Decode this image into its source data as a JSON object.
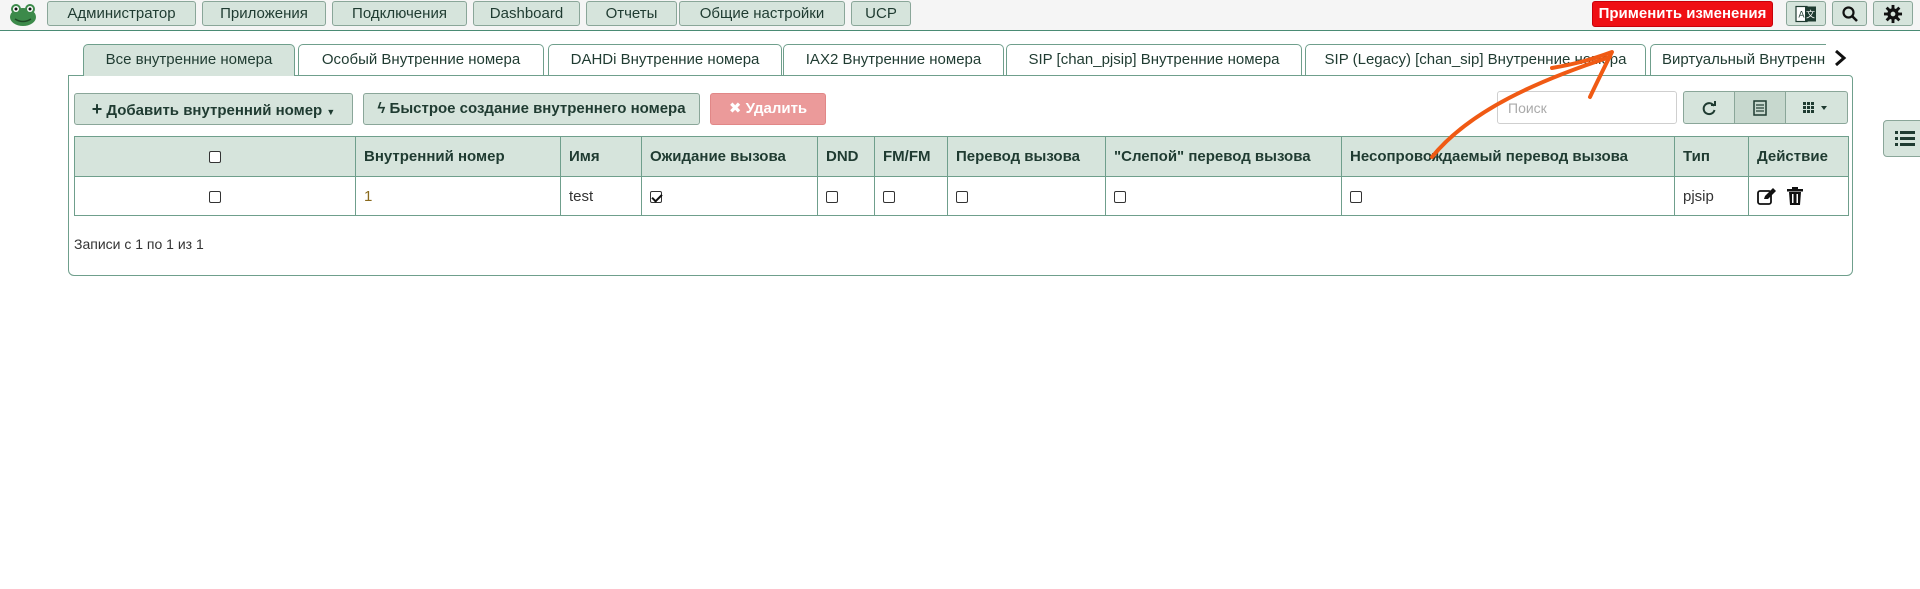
{
  "navbar": {
    "menu": [
      {
        "label": "Администратор"
      },
      {
        "label": "Приложения"
      },
      {
        "label": "Подключения"
      },
      {
        "label": "Dashboard"
      },
      {
        "label": "Отчеты"
      },
      {
        "label": "Общие настройки"
      },
      {
        "label": "UCP"
      }
    ],
    "apply_label": "Применить изменения"
  },
  "tabs": [
    {
      "label": "Все внутренние номера",
      "active": true
    },
    {
      "label": "Особый Внутренние номера"
    },
    {
      "label": "DAHDi Внутренние номера"
    },
    {
      "label": "IAX2 Внутренние номера"
    },
    {
      "label": "SIP [chan_pjsip] Внутренние номера"
    },
    {
      "label": "SIP (Legacy) [chan_sip] Внутренние номера"
    },
    {
      "label": "Виртуальный Внутренние номера"
    }
  ],
  "toolbar": {
    "add_label": "Добавить внутренний номер",
    "quick_create_label": "Быстрое создание внутреннего номера",
    "delete_label": "Удалить",
    "search_placeholder": "Поиск"
  },
  "table": {
    "columns": [
      "",
      "Внутренний номер",
      "Имя",
      "Ожидание вызова",
      "DND",
      "FM/FM",
      "Перевод вызова",
      "\"Слепой\" перевод вызова",
      "Несопровождаемый перевод вызова",
      "Тип",
      "Действие"
    ],
    "rows": [
      {
        "extension": "1",
        "name": "test",
        "call_waiting": true,
        "dnd": false,
        "fmfm": false,
        "call_transfer": false,
        "blind_transfer": false,
        "attended_transfer": false,
        "type": "pjsip"
      }
    ]
  },
  "footer": {
    "records_text": "Записи с 1 по 1 из 1"
  },
  "colors": {
    "accent": "#d6e4dc",
    "border": "#6f9f8c",
    "apply": "#ef0f14",
    "annotation_arrow": "#f05a14"
  }
}
